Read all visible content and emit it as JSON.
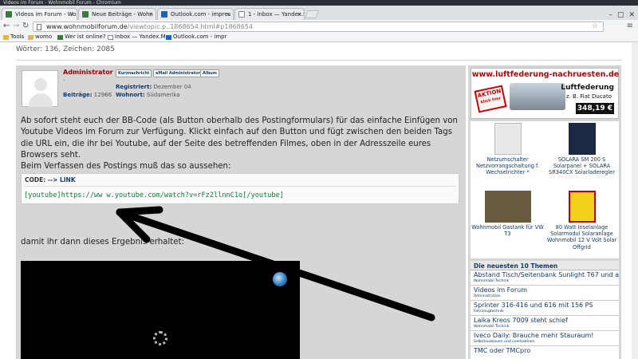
{
  "window": {
    "title": "Videos im Forum - Wohnmobil Forum - Chromium"
  },
  "tabs": [
    {
      "label": "Videos im Forum - Wo",
      "active": true,
      "icon_color": "#3b7a3b"
    },
    {
      "label": "Neue Beiträge - Wohn",
      "active": false,
      "icon_color": "#3b7a3b"
    },
    {
      "label": "Outlook.com - impres",
      "active": false,
      "icon_color": "#1e63b8"
    },
    {
      "label": "1 - Inbox — Yandex.Ma",
      "active": false,
      "icon_color": "#dd3333"
    }
  ],
  "address": {
    "domain": "www.wohnmobilforum.de",
    "path": "/viewtopic.p..1868654.html#p1868654"
  },
  "bookmarks": [
    {
      "label": "Tools"
    },
    {
      "label": "womo"
    },
    {
      "label": "Wer ist online?"
    },
    {
      "label": "Inbox — Yandex.Ma"
    },
    {
      "label": "Outlook.com - impr"
    }
  ],
  "page": {
    "wordcount": "Wörter: 136, Zeichen: 2085",
    "post": {
      "author": "Administrator",
      "author_dot": ".",
      "buttons": [
        "Kurznachricht",
        "eMail Administrator",
        "Album"
      ],
      "beitraege_label": "Beiträge:",
      "beitraege_value": "12966",
      "registriert_label": "Registriert:",
      "registriert_value": "Dezember 04",
      "wohnort_label": "Wohnort:",
      "wohnort_value": "Südamerika",
      "paragraph1": "Ab sofort steht euch der BB-Code (als Button oberhalb des Postingformulars) für das einfache Einfügen von Youtube Videos im Forum zur Verfügung. Klickt einfach auf den Button und fügt zwischen den beiden Tags die URL ein, die ihr bei Youtube, auf der Seite des betreffenden Filmes, oben in der Adresszeile eures Browsers seht.",
      "paragraph2": "Beim Verfassen des Postings muß das so aussehen:",
      "code_label": "CODE:",
      "code_link": "--> LINK",
      "code": "[youtube]https://ww w.youtube.com/watch?v=rFz2llnnC1o[/youtube]",
      "paragraph3": "damit ihr dann dieses Ergebnis erhaltet:"
    },
    "sidebar": {
      "ad": {
        "url": "www.luftfederung-nachruesten.de",
        "badge": "AKTION",
        "badge_sub": "klick hier",
        "title": "Luftfederung",
        "subtitle": "z. B. Fiat Ducato",
        "price": "348,19 €"
      },
      "products": [
        {
          "label": "Netzumschalter Netzvorrangschaltung f. Wechselrichter *",
          "color": "#e9e9e9"
        },
        {
          "label": "SOLARA SM 200 S Solarpanel + SOLARA SR340CX Solarladeregler",
          "color": "#1a2a44"
        },
        {
          "label": "Wohnmobil Gastank für VW T3",
          "color": "#6a5a40"
        },
        {
          "label": "80 Watt Inselanlage Solarmodul Solaranlage Wohnmobil 12 V Volt Solar Offgrid",
          "color": "#f3d11a"
        }
      ],
      "news_header": "Die neuesten 10 Themen",
      "news": [
        {
          "title": "Abstand Tisch/Seitenbank Sunlight T67 und andere",
          "category": "Wohnmobil Technik"
        },
        {
          "title": "Videos im Forum",
          "category": "Administration"
        },
        {
          "title": "Sprinter 316-416 und 616 mit 156 PS",
          "category": "Fahrzeugtechnik"
        },
        {
          "title": "Laika Kreos 7009 steht schief",
          "category": "Wohnmobil Technik"
        },
        {
          "title": "Iveco Daily: Brauche mehr Stauraum!",
          "category": "Selbstausbauen und Leerkabinen"
        },
        {
          "title": "TMC oder TMCpro",
          "category": ""
        }
      ]
    }
  }
}
